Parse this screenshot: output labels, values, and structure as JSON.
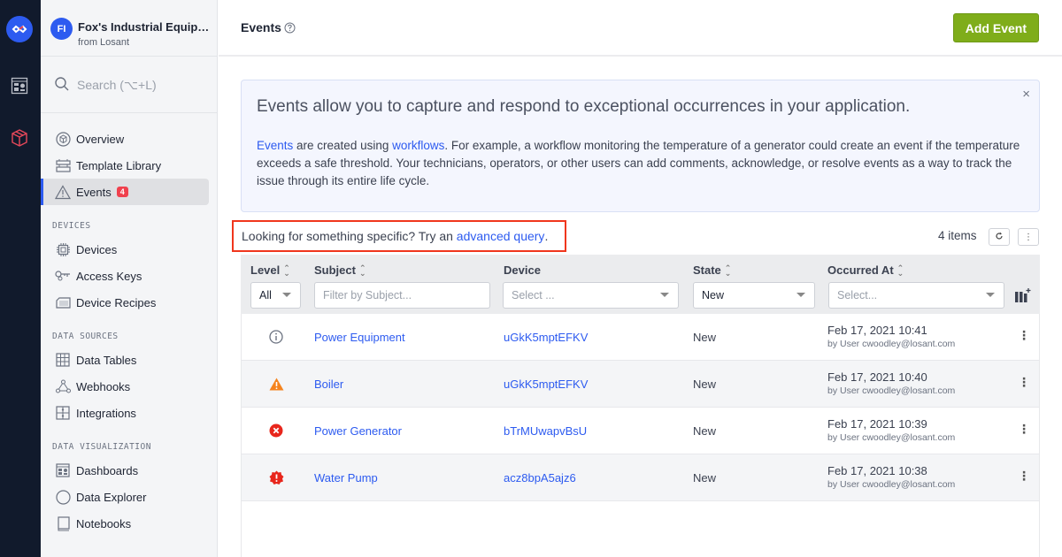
{
  "app": {
    "initials": "FI",
    "name": "Fox's Industrial Equipm...",
    "subtitle": "from Losant"
  },
  "search": {
    "placeholder": "Search (⌥+L)"
  },
  "sidebar": {
    "items": [
      {
        "label": "Overview",
        "icon": "overview-icon"
      },
      {
        "label": "Template Library",
        "icon": "template-library-icon"
      },
      {
        "label": "Events",
        "icon": "warning-triangle-icon",
        "badge": "4",
        "active": true
      }
    ],
    "sections": [
      {
        "title": "DEVICES",
        "items": [
          {
            "label": "Devices",
            "icon": "chip-icon"
          },
          {
            "label": "Access Keys",
            "icon": "key-icon"
          },
          {
            "label": "Device Recipes",
            "icon": "recipe-icon"
          }
        ]
      },
      {
        "title": "DATA SOURCES",
        "items": [
          {
            "label": "Data Tables",
            "icon": "table-icon"
          },
          {
            "label": "Webhooks",
            "icon": "webhook-icon"
          },
          {
            "label": "Integrations",
            "icon": "integrations-icon"
          }
        ]
      },
      {
        "title": "DATA VISUALIZATION",
        "items": [
          {
            "label": "Dashboards",
            "icon": "dashboard-icon"
          },
          {
            "label": "Data Explorer",
            "icon": "compass-icon"
          },
          {
            "label": "Notebooks",
            "icon": "notebook-icon"
          }
        ]
      }
    ]
  },
  "header": {
    "title": "Events",
    "add_button": "Add Event"
  },
  "info": {
    "title": "Events allow you to capture and respond to exceptional occurrences in your application.",
    "link1": "Events",
    "text1": " are created using ",
    "link2": "workflows",
    "text2": ". For example, a workflow monitoring the temperature of a generator could create an event if the temperature exceeds a safe threshold. Your technicians, operators, or other users can add comments, acknowledge, or resolve events as a way to track the issue through its entire life cycle.",
    "close": "×"
  },
  "query": {
    "prefix": "Looking for something specific? Try an ",
    "link": "advanced query",
    "suffix": "."
  },
  "list": {
    "count": "4 items",
    "columns": {
      "level": "Level",
      "subject": "Subject",
      "device": "Device",
      "state": "State",
      "occurred": "Occurred At"
    },
    "filters": {
      "level": "All",
      "subject_placeholder": "Filter by Subject...",
      "device_placeholder": "Select ...",
      "state": "New",
      "occurred_placeholder": "Select..."
    },
    "rows": [
      {
        "level": "info",
        "subject": "Power Equipment",
        "device": "uGkK5mptEFKV",
        "state": "New",
        "date": "Feb 17, 2021 10:41",
        "by": "by User cwoodley@losant.com"
      },
      {
        "level": "warning",
        "subject": "Boiler",
        "device": "uGkK5mptEFKV",
        "state": "New",
        "date": "Feb 17, 2021 10:40",
        "by": "by User cwoodley@losant.com"
      },
      {
        "level": "error",
        "subject": "Power Generator",
        "device": "bTrMUwapvBsU",
        "state": "New",
        "date": "Feb 17, 2021 10:39",
        "by": "by User cwoodley@losant.com"
      },
      {
        "level": "critical",
        "subject": "Water Pump",
        "device": "acz8bpA5ajz6",
        "state": "New",
        "date": "Feb 17, 2021 10:38",
        "by": "by User cwoodley@losant.com"
      }
    ]
  },
  "colors": {
    "accent": "#2d5bf0",
    "rail": "#111a2c",
    "add_button": "#7fad1a",
    "badge": "#f0414e",
    "warning": "#f5841f",
    "error": "#e8261c",
    "highlight_border": "#f0361d"
  }
}
